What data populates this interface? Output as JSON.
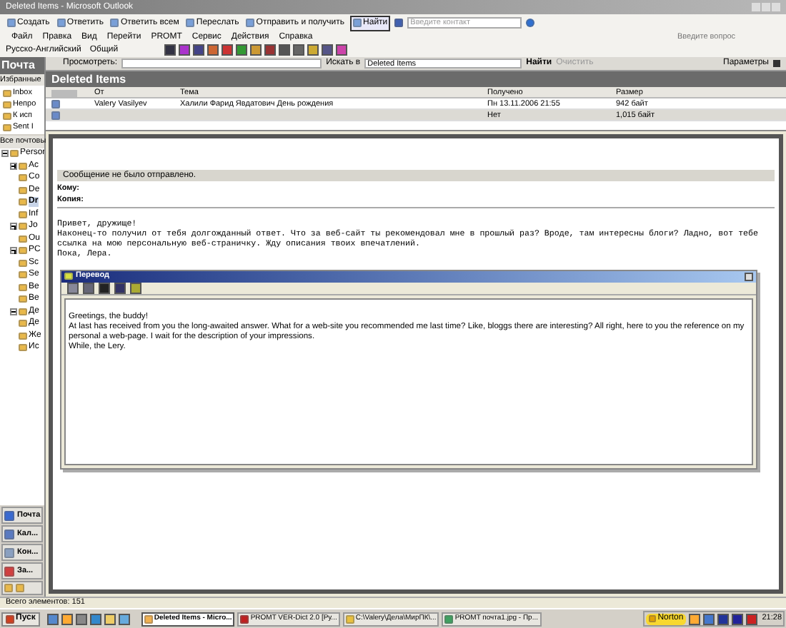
{
  "window": {
    "title": "Deleted Items - Microsoft Outlook"
  },
  "toolbar": {
    "buttons": [
      "Создать",
      "Ответить",
      "Ответить всем",
      "Переслать",
      "Отправить и получить",
      "Найти"
    ],
    "contact_placeholder": "Введите контакт"
  },
  "menu": [
    "Файл",
    "Правка",
    "Вид",
    "Перейти",
    "PROMT",
    "Сервис",
    "Действия",
    "Справка"
  ],
  "help_placeholder": "Введите вопрос",
  "promt": {
    "direction": "Русско-Английский",
    "topic": "Общий"
  },
  "nav": {
    "title": "Почта",
    "favorites_label": "Избранные",
    "favorites": [
      "Inbox",
      "Непро",
      "К исп",
      "Sent I"
    ],
    "all_label": "Все почтовы",
    "tree": [
      {
        "label": "Persor",
        "expanded": true,
        "children": [
          {
            "label": "Ac",
            "expanded": false
          },
          {
            "label": "Co"
          },
          {
            "label": "De",
            "selected": false
          },
          {
            "label": "Dr",
            "selected": true
          },
          {
            "label": "Inf"
          },
          {
            "label": "Jo",
            "expanded": false
          },
          {
            "label": "Ou"
          },
          {
            "label": "PC",
            "expanded": false
          },
          {
            "label": "Sc"
          },
          {
            "label": "Se"
          },
          {
            "label": "Be"
          },
          {
            "label": "Be"
          },
          {
            "label": "Де",
            "expanded": true
          },
          {
            "label": "Де"
          },
          {
            "label": "Же"
          },
          {
            "label": "Ис"
          }
        ]
      }
    ],
    "buttons": [
      "Почта",
      "Кал...",
      "Кон...",
      "За..."
    ]
  },
  "search": {
    "label": "Просмотреть:",
    "scope_label": "Искать в",
    "scope": "Deleted Items",
    "find": "Найти",
    "clear": "Очистить",
    "options": "Параметры"
  },
  "folder_title": "Deleted Items",
  "table": {
    "columns": [
      "От",
      "Тема",
      "Получено",
      "Размер"
    ],
    "rows": [
      {
        "from": "Valery Vasilyev",
        "subject": "Халили Фарид Явдатович День рождения",
        "received": "Пн 13.11.2006 21:55",
        "size": "942 байт",
        "selected": false
      },
      {
        "from": "",
        "subject": "",
        "received": "Нет",
        "size": "1,015 байт",
        "selected": true
      }
    ]
  },
  "message": {
    "notice": "Сообщение не было отправлено.",
    "to_label": "Кому:",
    "cc_label": "Копия:",
    "body": [
      "Привет, дружище!",
      "Наконец-то получил от тебя долгожданный ответ. Что за веб-сайт ты рекомендовал мне в прошлый раз? Вроде, там интересны блоги? Ладно, вот тебе",
      "ссылка на мою персональную веб-страничку. Жду описания твоих впечатлений.",
      "Пока, Лера."
    ]
  },
  "translation": {
    "title": "Перевод",
    "body": [
      "Greetings, the buddy!",
      "At last has received from you the long-awaited answer. What for a web-site you recommended me last time? Like, bloggs there are interesting? All right, here to you the reference on my personal a web-page. I wait for the description of your impressions.",
      "While, the Lery."
    ]
  },
  "status_bar": "Всего элементов: 151",
  "taskbar": {
    "start": "Пуск",
    "tasks": [
      {
        "label": "Deleted Items - Micro...",
        "selected": true
      },
      {
        "label": "PROMT VER-Dict 2.0 [Ру...",
        "selected": false
      },
      {
        "label": "C:\\Valery\\Дела\\МирПК\\...",
        "selected": false
      },
      {
        "label": "PROMT почта1.jpg - Пр...",
        "selected": false
      }
    ],
    "tray_button": "Norton",
    "clock": "21:28"
  }
}
